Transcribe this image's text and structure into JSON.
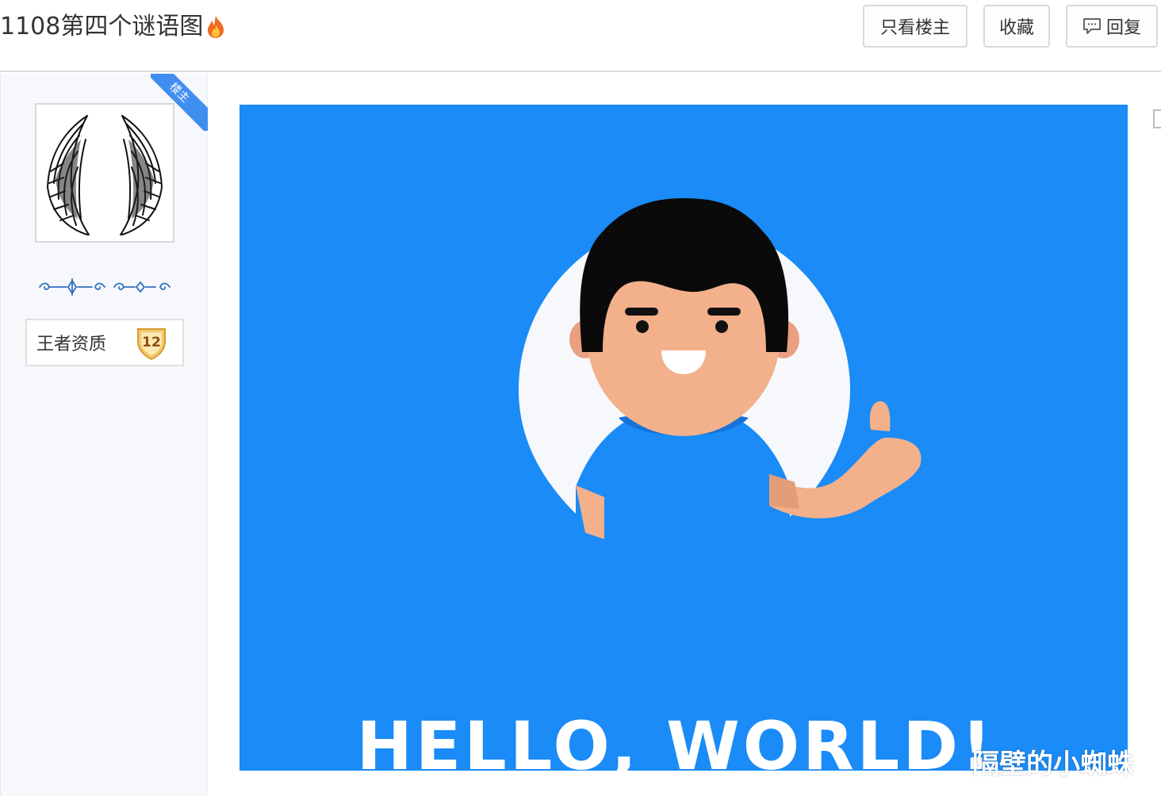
{
  "header": {
    "title": "1108第四个谜语图",
    "title_icon": "flame-icon",
    "buttons": {
      "only_op": "只看楼主",
      "favorite": "收藏",
      "reply": "回复"
    }
  },
  "sidebar": {
    "ribbon": "楼主",
    "avatar_icon": "angel-wings-avatar",
    "title_badge": "王者资质",
    "level": "12"
  },
  "post": {
    "image_text": "HELLO, WORLD!",
    "image_bg": "#1a8bf7",
    "watermark": "隔壁的小蜘蛛"
  },
  "colors": {
    "accent": "#3f8ef0",
    "image_blue": "#1a8bf7"
  }
}
